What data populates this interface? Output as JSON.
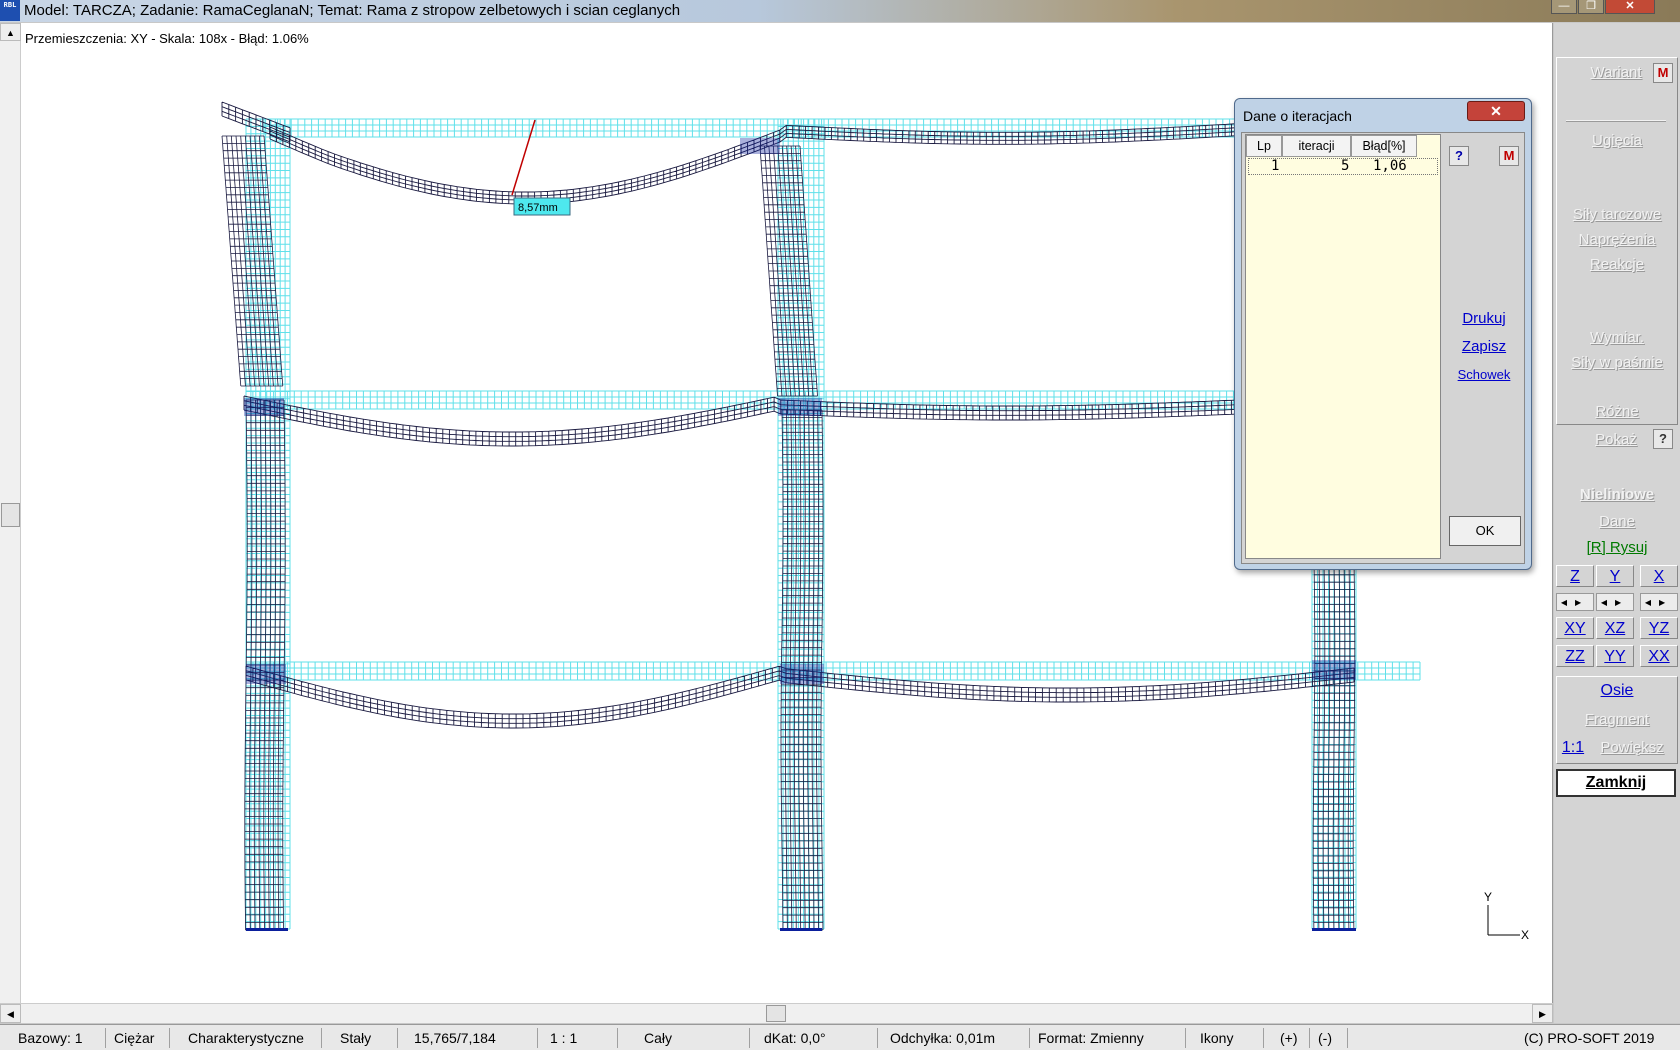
{
  "window": {
    "title": "Model: TARCZA;  Zadanie: RamaCeglanaN;  Temat: Rama z stropow zelbetowych i scian ceglanych",
    "app_icon_text": "RBL",
    "minimize_glyph": "—",
    "maximize_glyph": "❐",
    "close_glyph": "✕"
  },
  "canvas": {
    "info_line": "Przemieszczenia: XY  -  Skala: 108x  -  Błąd: 1.06%",
    "displacement_label": "8,57mm",
    "axis_y": "Y",
    "axis_x": "X",
    "scroll_up": "▲",
    "scroll_left": "◀",
    "scroll_right": "▶"
  },
  "panel": {
    "wariant": "Wariant",
    "wariant_badge": "M",
    "ugiecia": "Ugięcia",
    "sily_tarczowe": "Siły tarczowe",
    "naprezenia": "Naprężenia",
    "reakcje": "Reakcje",
    "wymiar": "Wymiar.",
    "sily_w_pasmie": "Siły w paśmie",
    "rozne": "Różne",
    "pokaz": "Pokaż",
    "pokaz_help": "?",
    "nieliniowe": "Nieliniowe",
    "dane": "Dane",
    "rysuj": "[R] Rysuj",
    "view_z": "Z",
    "view_y": "Y",
    "view_x": "X",
    "arrows": "◀▶",
    "view_xy": "XY",
    "view_xz": "XZ",
    "view_yz": "YZ",
    "view_zz": "ZZ",
    "view_yy": "YY",
    "view_xx": "XX",
    "osie": "Osie",
    "fragment": "Fragment",
    "scale_11": "1:1",
    "powieksz": "Powiększ",
    "zamknij": "Zamknij"
  },
  "dialog": {
    "title": "Dane o iteracjach",
    "close": "✕",
    "columns": [
      "Lp",
      "iteracji",
      "Błąd[%]"
    ],
    "rows": [
      {
        "lp": "1",
        "iter": "5",
        "err": "1,06"
      }
    ],
    "help": "?",
    "badge": "M",
    "drukuj": "Drukuj",
    "zapisz": "Zapisz",
    "schowek": "Schowek",
    "ok": "OK"
  },
  "status": {
    "bazowy": "Bazowy: 1",
    "ciezar": "Ciężar",
    "charakt": "Charakterystyczne",
    "staly": "Stały",
    "coords": "15,765/7,184",
    "scale": "1 : 1",
    "caly": "Cały",
    "dkat": "dKat: 0,0°",
    "odchylka": "Odchyłka: 0,01m",
    "format": "Format: Zmienny",
    "ikony": "Ikony",
    "plus": "(+)",
    "minus": "(-)",
    "copyright": "(C) PRO-SOFT 2019"
  },
  "colors": {
    "original_mesh": "#5fe0ea",
    "deformed_mesh": "#1a1a40",
    "deformed_highlight": "#0b1f9c",
    "marker_line": "#c00000",
    "label_bg": "#4ee8ee"
  }
}
